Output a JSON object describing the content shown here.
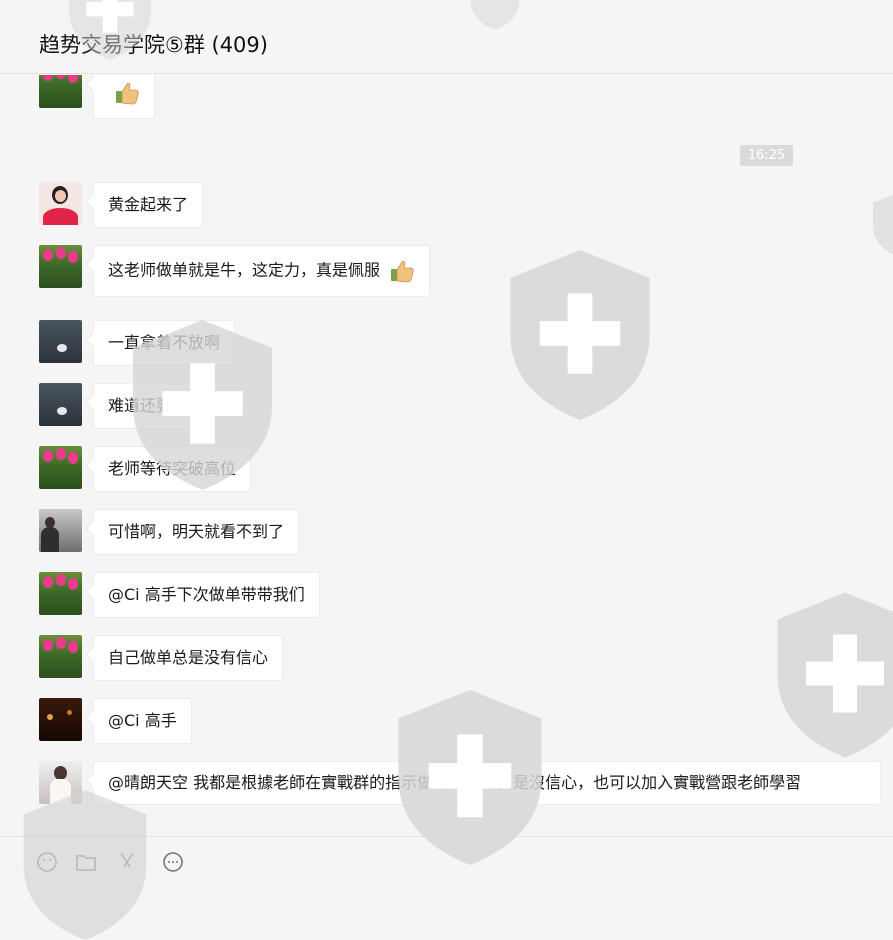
{
  "window": {
    "title": "趋势交易学院⑤群 (409)"
  },
  "timestamp": "16:25",
  "messages": [
    {
      "avatar": "flower-avatar",
      "text": ""
    },
    {
      "avatar": "girl-flowers-avatar",
      "text": "黄金起来了"
    },
    {
      "avatar": "flower-avatar",
      "text": "这老师做单就是牛，这定力，真是佩服"
    },
    {
      "avatar": "water-drop-avatar",
      "text": "一直拿着不放啊"
    },
    {
      "avatar": "water-drop-avatar",
      "text": "难道还要涨"
    },
    {
      "avatar": "flower-avatar",
      "text": "老师等待突破高位"
    },
    {
      "avatar": "person-avatar",
      "text": "可惜啊，明天就看不到了"
    },
    {
      "avatar": "flower-avatar",
      "text": "@Ci 高手下次做单带带我们"
    },
    {
      "avatar": "flower-avatar",
      "text": "自己做单总是没有信心"
    },
    {
      "avatar": "night-avatar",
      "text": "@Ci  高手"
    },
    {
      "avatar": "woman-avatar",
      "text": "@晴朗天空 我都是根據老師在實戰群的指示做單的，你要是沒信心，也可以加入實戰營跟老師學習"
    }
  ],
  "icons": [
    "thumbs-up-icon",
    "emoji-icon",
    "folder-icon",
    "scissors-icon",
    "chat-icon",
    "shield-watermark-icon"
  ],
  "colors": {
    "bubble": "#ffffff",
    "background": "#f5f5f5",
    "timestamp_bg": "#dadada",
    "flower": "#ea3b8d"
  }
}
